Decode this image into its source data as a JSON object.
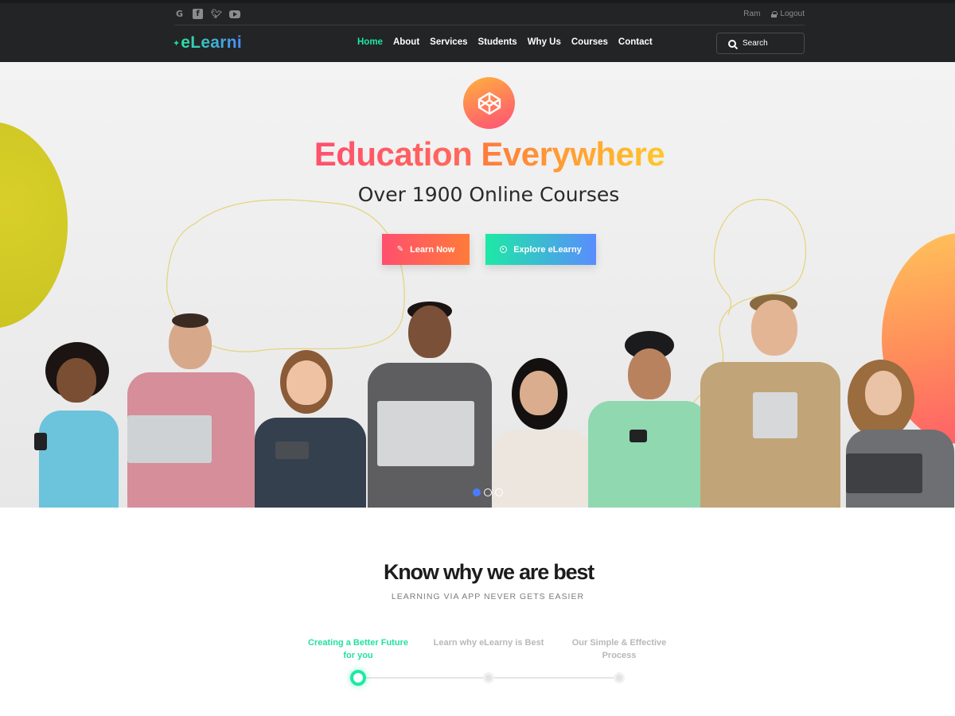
{
  "topbar": {
    "social_icons": [
      "google-icon",
      "facebook-icon",
      "twitter-icon",
      "youtube-icon"
    ],
    "username": "Ram",
    "logout_label": "Logout"
  },
  "header": {
    "logo_text": "eLearni",
    "nav": [
      {
        "label": "Home",
        "active": true
      },
      {
        "label": "About",
        "active": false
      },
      {
        "label": "Services",
        "active": false
      },
      {
        "label": "Students",
        "active": false
      },
      {
        "label": "Why Us",
        "active": false
      },
      {
        "label": "Courses",
        "active": false
      },
      {
        "label": "Contact",
        "active": false
      }
    ],
    "search_placeholder": "Search"
  },
  "hero": {
    "badge_icon": "codepen-cube-icon",
    "title_part1": "Education",
    "title_part2": "Everywhere",
    "subtitle": "Over 1900 Online Courses",
    "learn_button": "Learn Now",
    "explore_button": "Explore eLearny",
    "carousel": {
      "slides": 3,
      "active": 1
    }
  },
  "features": {
    "title": "Know why we are best",
    "subtitle": "LEARNING VIA APP NEVER GETS EASIER",
    "steps": [
      {
        "label": "Creating a Better Future for you",
        "active": true
      },
      {
        "label": "Learn why eLearny is Best",
        "active": false
      },
      {
        "label": "Our Simple & Effective Process",
        "active": false
      }
    ]
  },
  "colors": {
    "accent_green": "#1de9a5",
    "accent_blue": "#4a7cff",
    "accent_red": "#ff4f6e",
    "accent_orange": "#ffc72a",
    "topbar_bg": "#232425"
  }
}
